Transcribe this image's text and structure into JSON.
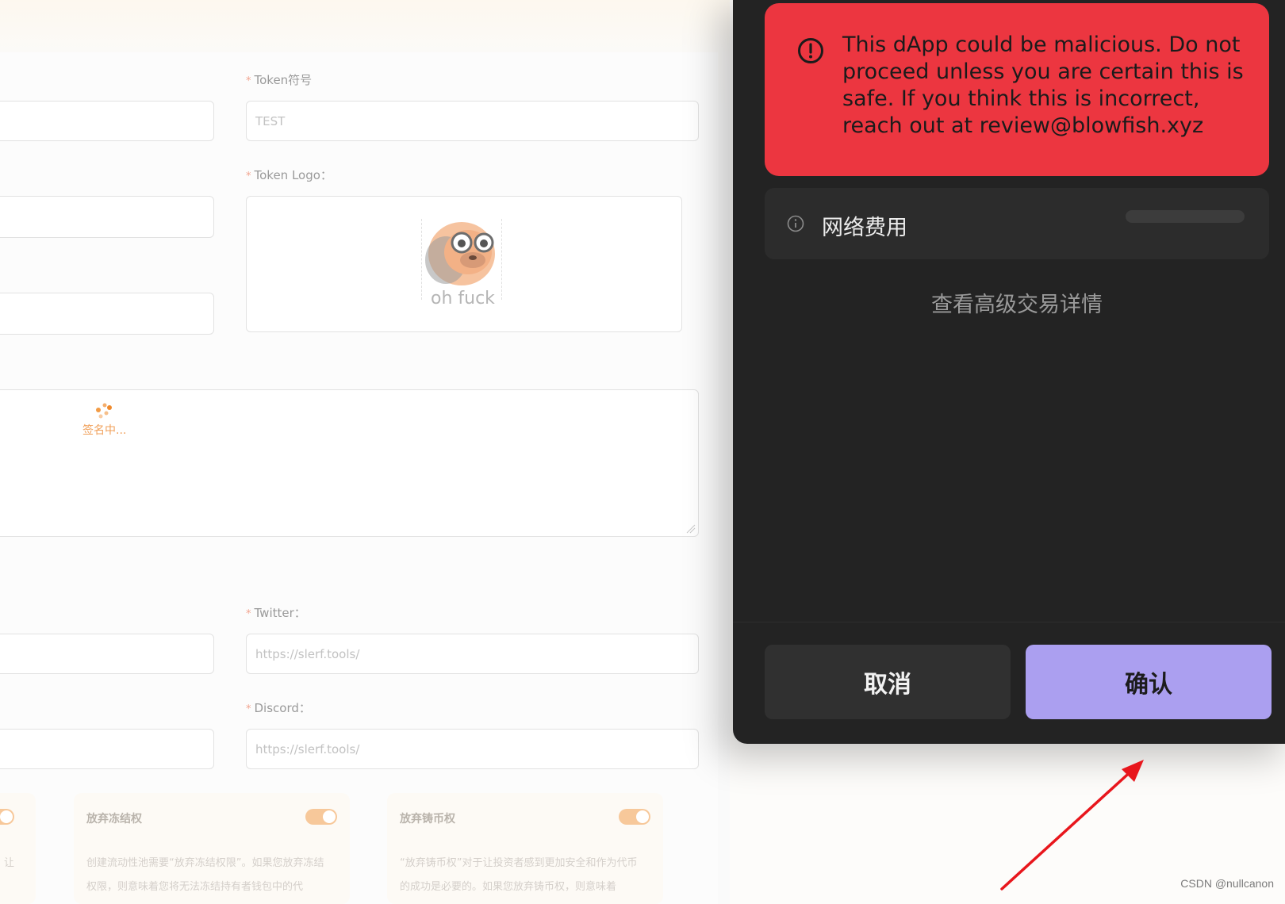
{
  "form": {
    "symbol": {
      "label": "Token符号",
      "placeholder": "TEST"
    },
    "logo": {
      "label": "Token Logo：",
      "image_caption": "oh fuck"
    },
    "signing_text": "签名中...",
    "twitter": {
      "label": "Twitter：",
      "placeholder": "https://slerf.tools/"
    },
    "discord": {
      "label": "Discord：",
      "placeholder": "https://slerf.tools/"
    },
    "toggles": [
      {
        "title": "",
        "desc": "让",
        "enabled": true
      },
      {
        "title": "放弃冻结权",
        "desc": "创建流动性池需要“放弃冻结权限”。如果您放弃冻结权限，则意味着您将无法冻结持有者钱包中的代",
        "enabled": true
      },
      {
        "title": "放弃铸币权",
        "desc": "“放弃铸币权”对于让投资者感到更加安全和作为代币的成功是必要的。如果您放弃铸币权，则意味着",
        "enabled": true
      }
    ]
  },
  "wallet": {
    "alert": {
      "icon": "exclamation-circle-icon",
      "text": "This dApp could be malicious. Do not proceed unless you are certain this is safe. If you think this is incorrect, reach out at review@blowfish.xyz",
      "color": "#ec3640"
    },
    "network_fee": {
      "icon": "info-icon",
      "label": "网络费用"
    },
    "advanced_link": "查看高级交易详情",
    "cancel_button": "取消",
    "confirm_button": "确认",
    "confirm_color": "#ab9ff0"
  },
  "annotation": {
    "arrow_color": "#e8161c"
  },
  "watermark": "CSDN @nullcanon"
}
